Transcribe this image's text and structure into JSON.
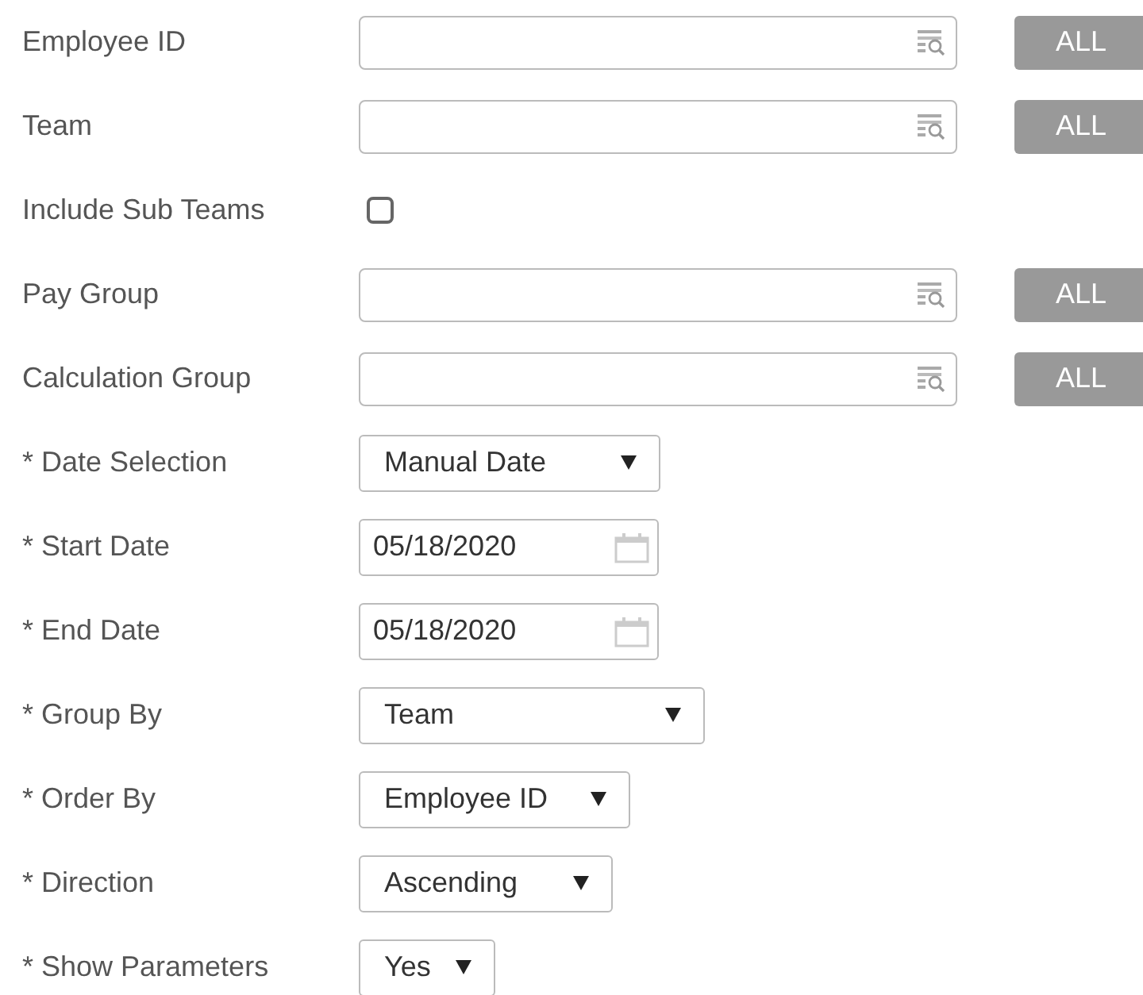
{
  "fields": [
    {
      "kind": "lookup",
      "label": "Employee ID",
      "button": "ALL"
    },
    {
      "kind": "lookup",
      "label": "Team",
      "button": "ALL"
    },
    {
      "kind": "checkbox",
      "label": "Include Sub Teams",
      "checked": false
    },
    {
      "kind": "lookup",
      "label": "Pay Group",
      "button": "ALL"
    },
    {
      "kind": "lookup",
      "label": "Calculation Group",
      "button": "ALL"
    },
    {
      "kind": "select",
      "label": "* Date Selection",
      "value": "Manual Date"
    },
    {
      "kind": "date",
      "label": "* Start Date",
      "value": "05/18/2020"
    },
    {
      "kind": "date",
      "label": "* End Date",
      "value": "05/18/2020"
    },
    {
      "kind": "select",
      "label": "* Group By",
      "value": "Team"
    },
    {
      "kind": "select",
      "label": "* Order By",
      "value": "Employee ID"
    },
    {
      "kind": "select",
      "label": "* Direction",
      "value": "Ascending"
    },
    {
      "kind": "select",
      "label": "* Show Parameters",
      "value": "Yes"
    }
  ]
}
